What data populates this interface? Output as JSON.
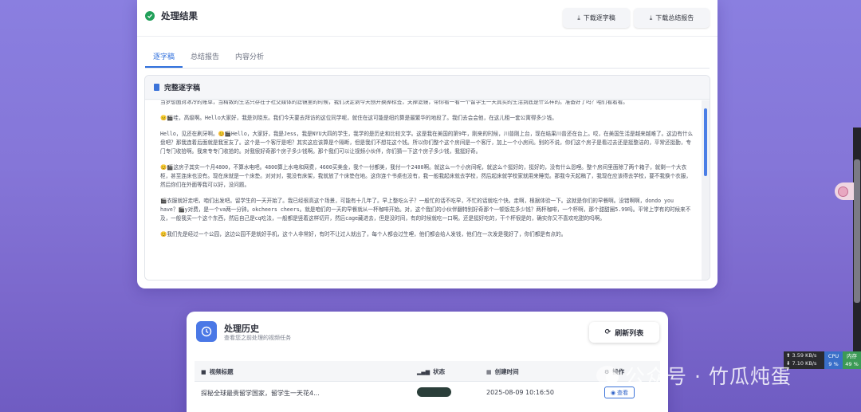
{
  "result": {
    "title": "处理结果",
    "buttons": {
      "download_transcript": "下载逐字稿",
      "download_summary": "下载总结报告"
    },
    "tabs": [
      "逐字稿",
      "总结报告",
      "内容分析"
    ],
    "active_tab": "逐字稿",
    "panel_title": "完整逐字稿",
    "transcript": [
      "当梦想面对冰冷的账单，当精致的生活只存在于社交媒体的滤镜里的时候，我们决定剥今天刨开换掉标签，关掉滤镜，带你看一看一个留学生一天真实的生活到底是什么样的。准备好了吗？咱们看着看。",
      "😐🎬哇，高级啊。Hello大家好，我是刘晓东。我们今天要去拜访的这位同学呢，就住在这可能是纽约算是最繁华的地段了。我们去会会他，在这儿租一套公寓得多少钱。",
      "Hello，见还在刷牙啊。😊🎬Hello，大家好，我是Jess，我是NYU大四的学生，我学的是历史和比较文学。这是我在美国的第9年，刚来的时候，川普刚上台，现在结果川普还在台上。哎，在美国生活是越来越难了。这边有什么盘吧？那我连着后面就是我室友了。这个是一个客厅是吧？其实这应该算是个隔断，但是我们不想花这个钱。所以你们整个这个房间是一个客厅，加上一个小房间。别的不说，你们这个房子是看过去还是挺整洁的，平常还挺勤，专门专门收拾啊。我来专专门收拾的。对我很好奇那个房子多少钱啊。那个我们可以让视频小伙伴，你们猜一下这个房子多少钱，我挺好奇。",
      "😊🎬这房子其实一个月4800，不算水电吧。4800算上水电和网费，4600买美金，我个一付都美，我付一个2400啊。就这么一个小房间呢，就这么个挺好的，挺好的，没有什么怨哩。整个房间里面除了两个箱子，就剩一个大衣柜，甚至连床也没有。现在床就是一个床垫。对对对，我没有床架，我就放了个床垫在地。这你连个书桌也没有，我一般我起床就去学校，然后起床就学校家就用来睡觉。那我今天起稿了，我现在应该得去学校，要不我换个衣服，然后你们在外面等我可以好，没问题。",
      "🎬衣服就好走吧，咱们出发吧。留学生的一天开始了。我已经很高这个场景，可能有十几年了。早上整吃么子？一般忙的话不吃早，不忙的话就吃个快。走啊，根据体验一下。这就是你们的早餐啊。没错啊啊，dondo you have？🎬y对费，是一个va两一分钟。okcheers cheers。就是咱们的一天的早餐就从一杯咖啡开始。对，这个我们的小伙伴翻特别好奇那个一顿饭花多少钱？两杯咖啡，一个杯啊，那个甜甜圈5.99吗。平常上学有的时候来不及，一般我买一个这个东西，然后自己是cq吃法，一般都是竖着这样切开，然后cage藏进去，但是没时间，有的时候就吃一口啊。还是挺好吃的，干个杯很是的，确实你又不喜欢吃甜的吗啊。",
      "😊我们先是经过一个公园，这边公园不是就好手机，这个人非常好，有时不让过人就出了，每个人都会过生哩，他们都会给人发钱，他们在一次发是我好了，你们都是有点的。"
    ]
  },
  "history": {
    "title": "处理历史",
    "subtitle": "查看您之前处理的视频任务",
    "refresh_label": "刷新列表",
    "columns": [
      "视频标题",
      "状态",
      "创建时间",
      "操作"
    ],
    "rows": [
      {
        "title": "探秘全球最贵留学国家，留学生一天花4...",
        "status": "完成",
        "created": "2025-08-09 10:16:50",
        "action": "查看"
      }
    ]
  },
  "system_monitor": {
    "upload": "3.59 KB/s",
    "download": "7.10 KB/s",
    "cpu_label": "CPU",
    "cpu_value": "9 %",
    "mem_label": "内存",
    "mem_value": "49 %"
  },
  "watermark": "公众号 · 竹瓜炖蛋",
  "colors": {
    "accent": "#2f6fdc",
    "success": "#22a05a",
    "status_pill": "#2b3f3a",
    "background": "#8576d8"
  }
}
